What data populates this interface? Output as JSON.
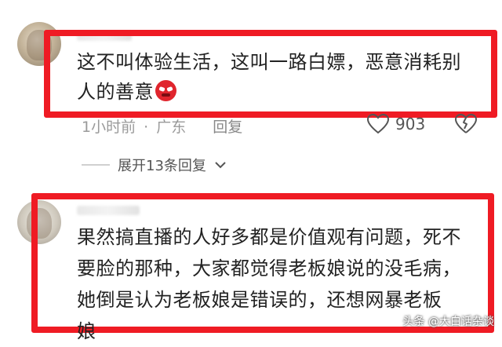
{
  "comments": [
    {
      "text_line1": "这不叫体验生活，这叫一路白嫖，恶意消耗别",
      "text_line2": "人的善意",
      "emoji_icon": "angry-face-icon",
      "time": "1小时前",
      "separator": "·",
      "location": "广东",
      "reply_label": "回复",
      "like_count": "903",
      "expand_label": "展开13条回复"
    },
    {
      "text_line1": "果然搞直播的人好多都是价值观有问题，死不",
      "text_line2": "要脸的那种，大家都觉得老板娘说的没毛病，",
      "text_line3": "她倒是认为老板娘是错误的，还想网暴老板",
      "text_line4": "娘"
    }
  ],
  "watermark": "头条 @大白话杂谈",
  "colors": {
    "highlight_box": "#ef1b24",
    "meta_text": "#9a9a9a"
  }
}
